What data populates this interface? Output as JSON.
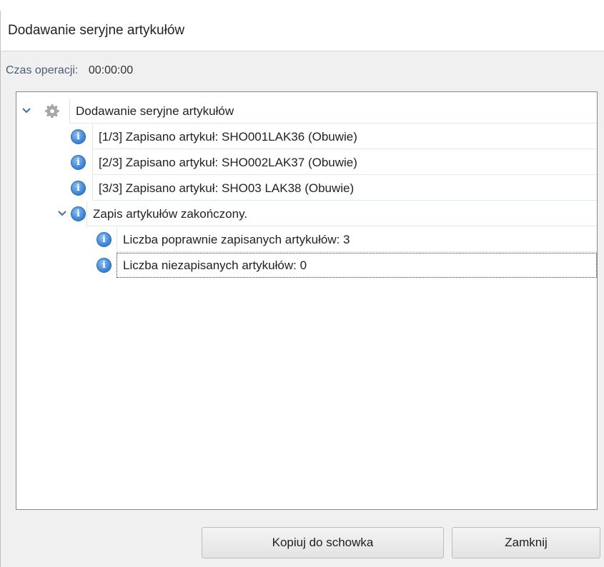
{
  "window": {
    "title": "Dodawanie seryjne artykułów"
  },
  "operation_time": {
    "label": "Czas operacji:",
    "value": "00:00:00"
  },
  "tree": {
    "root": {
      "label": "Dodawanie seryjne artykułów",
      "icon": "gear-icon",
      "expanded": true
    },
    "items": [
      {
        "label": "[1/3] Zapisano artykuł: SHO001LAK36 (Obuwie)",
        "icon": "info-icon"
      },
      {
        "label": "[2/3] Zapisano artykuł: SHO002LAK37 (Obuwie)",
        "icon": "info-icon"
      },
      {
        "label": "[3/3] Zapisano artykuł: SHO03 LAK38 (Obuwie)",
        "icon": "info-icon"
      }
    ],
    "summary": {
      "label": "Zapis artykułów zakończony.",
      "icon": "info-icon",
      "expanded": true,
      "children": [
        {
          "label": "Liczba poprawnie zapisanych artykułów: 3",
          "icon": "info-icon"
        },
        {
          "label": "Liczba niezapisanych artykułów: 0",
          "icon": "info-icon",
          "selected": true
        }
      ]
    }
  },
  "buttons": {
    "copy_label": "Kopiuj do schowka",
    "close_label": "Zamknij"
  },
  "colors": {
    "info_blue": "#3f88d6",
    "label_blue_gray": "#4a5d7a"
  }
}
